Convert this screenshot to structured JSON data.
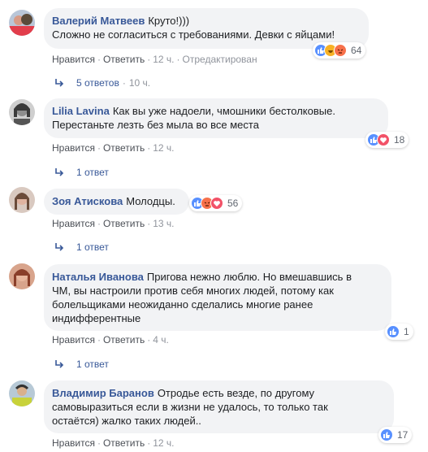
{
  "comments": [
    {
      "author": "Валерий Матвеев",
      "text_line1": "Круто!)))",
      "text_line2": "Сложно не согласиться с требованиями. Девки с яйцами!",
      "like_label": "Нравится",
      "reply_label": "Ответить",
      "time": "12 ч.",
      "edited": "Отредактирован",
      "reaction_count": "64",
      "reactions": [
        "like-icon",
        "haha-icon",
        "angry-icon"
      ],
      "replies_label": "5 ответов",
      "replies_time": "10 ч."
    },
    {
      "author": "Lilia Lavina",
      "text_line1": "Как вы уже надоели, чмошники бестолковые.",
      "text_line2": "Перестаньте лезть без мыла во все места",
      "like_label": "Нравится",
      "reply_label": "Ответить",
      "time": "12 ч.",
      "reaction_count": "18",
      "reactions": [
        "like-icon",
        "love-icon"
      ],
      "replies_label": "1 ответ"
    },
    {
      "author": "Зоя Атискова",
      "text_line1": "Молодцы.",
      "like_label": "Нравится",
      "reply_label": "Ответить",
      "time": "13 ч.",
      "reaction_count": "56",
      "reactions": [
        "like-icon",
        "angry-icon",
        "love-icon"
      ],
      "replies_label": "1 ответ"
    },
    {
      "author": "Наталья Иванова",
      "text_line1": "Пригова нежно люблю. Но вмешавшись в",
      "text_line2": "ЧМ, вы настроили против себя многих людей, потому как",
      "text_line3": "болельщиками неожиданно сделались многие ранее",
      "text_line4": "индифферентные",
      "like_label": "Нравится",
      "reply_label": "Ответить",
      "time": "4 ч.",
      "reaction_count": "1",
      "reactions": [
        "like-icon"
      ],
      "replies_label": "1 ответ"
    },
    {
      "author": "Владимир Баранов",
      "text_line1": "Отродье есть везде, по другому",
      "text_line2": "самовыразиться если в жизни не удалось, то только так",
      "text_line3": "остаётся) жалко таких людей..",
      "like_label": "Нравится",
      "reply_label": "Ответить",
      "time": "12 ч.",
      "reaction_count": "17",
      "reactions": [
        "like-icon"
      ]
    }
  ],
  "colors": {
    "author": "#385898",
    "bubble": "#f2f3f5",
    "like": "#5890ff",
    "love": "#f25268",
    "angry": "#f7714b",
    "haha": "#f7b125",
    "meta": "#90949c"
  },
  "separator": "·"
}
